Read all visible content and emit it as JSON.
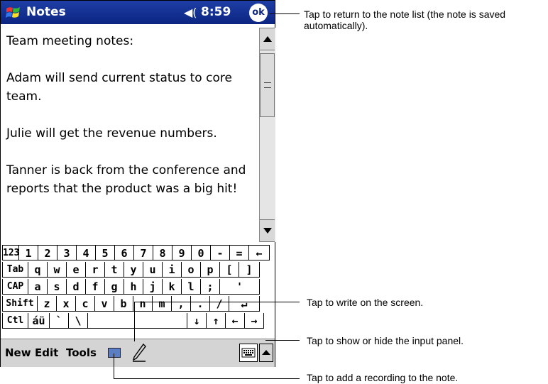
{
  "titlebar": {
    "app_title": "Notes",
    "speaker_glyph": "◀(",
    "time": "8:59",
    "ok_label": "ok"
  },
  "note": {
    "paragraphs": [
      "Team meeting notes:",
      "Adam will send current status to core team.",
      "Julie will get the revenue numbers.",
      "Tanner is back from the conference and reports that the product was a big hit!"
    ]
  },
  "keyboard": {
    "row1": [
      "123",
      "1",
      "2",
      "3",
      "4",
      "5",
      "6",
      "7",
      "8",
      "9",
      "0",
      "-",
      "=",
      "←"
    ],
    "row2": [
      "Tab",
      "q",
      "w",
      "e",
      "r",
      "t",
      "y",
      "u",
      "i",
      "o",
      "p",
      "[",
      "]"
    ],
    "row3": [
      "CAP",
      "a",
      "s",
      "d",
      "f",
      "g",
      "h",
      "j",
      "k",
      "l",
      ";",
      "'"
    ],
    "row4": [
      "Shift",
      "z",
      "x",
      "c",
      "v",
      "b",
      "n",
      "m",
      ",",
      ".",
      "/",
      "↵"
    ],
    "row5": [
      "Ctl",
      "áü",
      "`",
      "\\",
      "",
      "↓",
      "↑",
      "←",
      "→"
    ]
  },
  "menubar": {
    "new": "New",
    "edit": "Edit",
    "tools": "Tools"
  },
  "callouts": {
    "ok": "Tap to return to the note list (the note is saved automatically).",
    "pen": "Tap to write on the screen.",
    "input_panel": "Tap to show or hide the input panel.",
    "recording": "Tap to add a recording to the note."
  },
  "icons": [
    "windows-flag-icon",
    "speaker-icon",
    "ok-icon",
    "microphone-icon",
    "pen-icon",
    "keyboard-icon",
    "chevron-up-icon"
  ]
}
